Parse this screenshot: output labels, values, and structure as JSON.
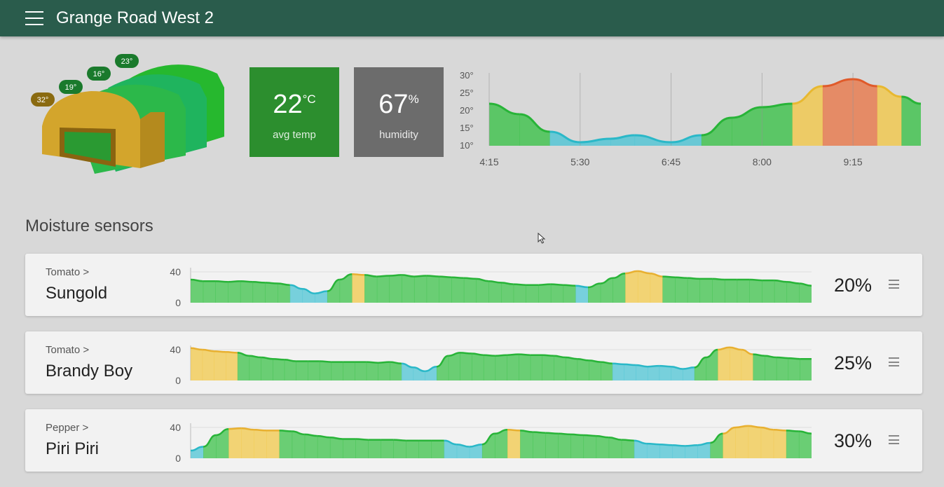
{
  "header": {
    "title": "Grange Road West 2",
    "menu_icon": "hamburger-menu-icon"
  },
  "greenhouse": {
    "zones": [
      {
        "label": "32°",
        "color": "#8a6a10",
        "body": "#d4a82e"
      },
      {
        "label": "19°",
        "color": "#1a7a2c",
        "body": "#2ab44e"
      },
      {
        "label": "16°",
        "color": "#1a7a2c",
        "body": "#28c06e"
      },
      {
        "label": "23°",
        "color": "#1a7a2c",
        "body": "#34b83a"
      }
    ]
  },
  "stats": {
    "avg_temp": {
      "value": "22",
      "unit": "°C",
      "caption": "avg temp",
      "color": "#2c8e2e"
    },
    "humidity": {
      "value": "67",
      "unit": "%",
      "caption": "humidity",
      "color": "#6c6c6c"
    }
  },
  "temp_chart": {
    "chart_data": {
      "type": "area",
      "y_ticks": [
        "30°",
        "25°",
        "20°",
        "15°",
        "10°"
      ],
      "ylim": [
        10,
        30
      ],
      "x_ticks": [
        "4:15",
        "5:30",
        "6:45",
        "8:00",
        "9:15"
      ],
      "x_tick_values": [
        0,
        75,
        150,
        225,
        300
      ],
      "xlim": [
        0,
        356
      ],
      "x": [
        0,
        25,
        50,
        75,
        100,
        120,
        150,
        175,
        200,
        225,
        250,
        275,
        300,
        320,
        340,
        356
      ],
      "values": [
        22,
        19,
        14,
        11,
        12,
        13,
        11,
        13,
        18,
        21,
        22,
        27,
        29,
        27,
        24,
        22
      ],
      "color_scale": {
        "cold": "#4ec4d4",
        "normal": "#3cc24a",
        "warm": "#f2c84a",
        "hot": "#e8784a"
      }
    }
  },
  "moisture": {
    "title": "Moisture sensors",
    "y_ticks": [
      "40",
      "0"
    ],
    "ylim": [
      0,
      40
    ],
    "colors": {
      "dry": "#4ec4d4",
      "ok": "#3cc24a",
      "wet": "#f2c84a"
    },
    "sensors": [
      {
        "category": "Tomato >",
        "name": "Sungold",
        "percent": "20%",
        "chart_data": {
          "type": "area",
          "values": [
            30,
            28,
            28,
            27,
            28,
            27,
            26,
            25,
            23,
            18,
            12,
            15,
            30,
            37,
            36,
            34,
            35,
            36,
            34,
            35,
            34,
            33,
            32,
            31,
            28,
            26,
            24,
            23,
            23,
            24,
            23,
            22,
            20,
            25,
            32,
            38,
            41,
            38,
            34,
            33,
            32,
            31,
            31,
            30,
            30,
            30,
            29,
            29,
            27,
            25,
            22
          ]
        }
      },
      {
        "category": "Tomato >",
        "name": "Brandy Boy",
        "percent": "25%",
        "chart_data": {
          "type": "area",
          "values": [
            42,
            40,
            38,
            37,
            36,
            32,
            30,
            28,
            27,
            25,
            25,
            25,
            24,
            24,
            24,
            24,
            23,
            24,
            22,
            17,
            12,
            18,
            32,
            36,
            35,
            33,
            32,
            33,
            34,
            33,
            33,
            32,
            30,
            28,
            26,
            24,
            22,
            21,
            20,
            18,
            19,
            18,
            15,
            17,
            30,
            40,
            43,
            40,
            34,
            32,
            30,
            29,
            28,
            28
          ]
        }
      },
      {
        "category": "Pepper >",
        "name": "Piri Piri",
        "percent": "30%",
        "chart_data": {
          "type": "area",
          "values": [
            10,
            15,
            30,
            38,
            39,
            37,
            36,
            36,
            35,
            31,
            29,
            27,
            25,
            25,
            24,
            24,
            24,
            23,
            23,
            23,
            23,
            18,
            15,
            18,
            32,
            37,
            36,
            34,
            33,
            32,
            31,
            30,
            29,
            27,
            24,
            23,
            19,
            18,
            17,
            16,
            17,
            20,
            32,
            40,
            42,
            40,
            37,
            36,
            35,
            32
          ]
        }
      }
    ]
  },
  "icons": {
    "cursor": "mouse-pointer-icon",
    "more": "more-menu-icon"
  }
}
